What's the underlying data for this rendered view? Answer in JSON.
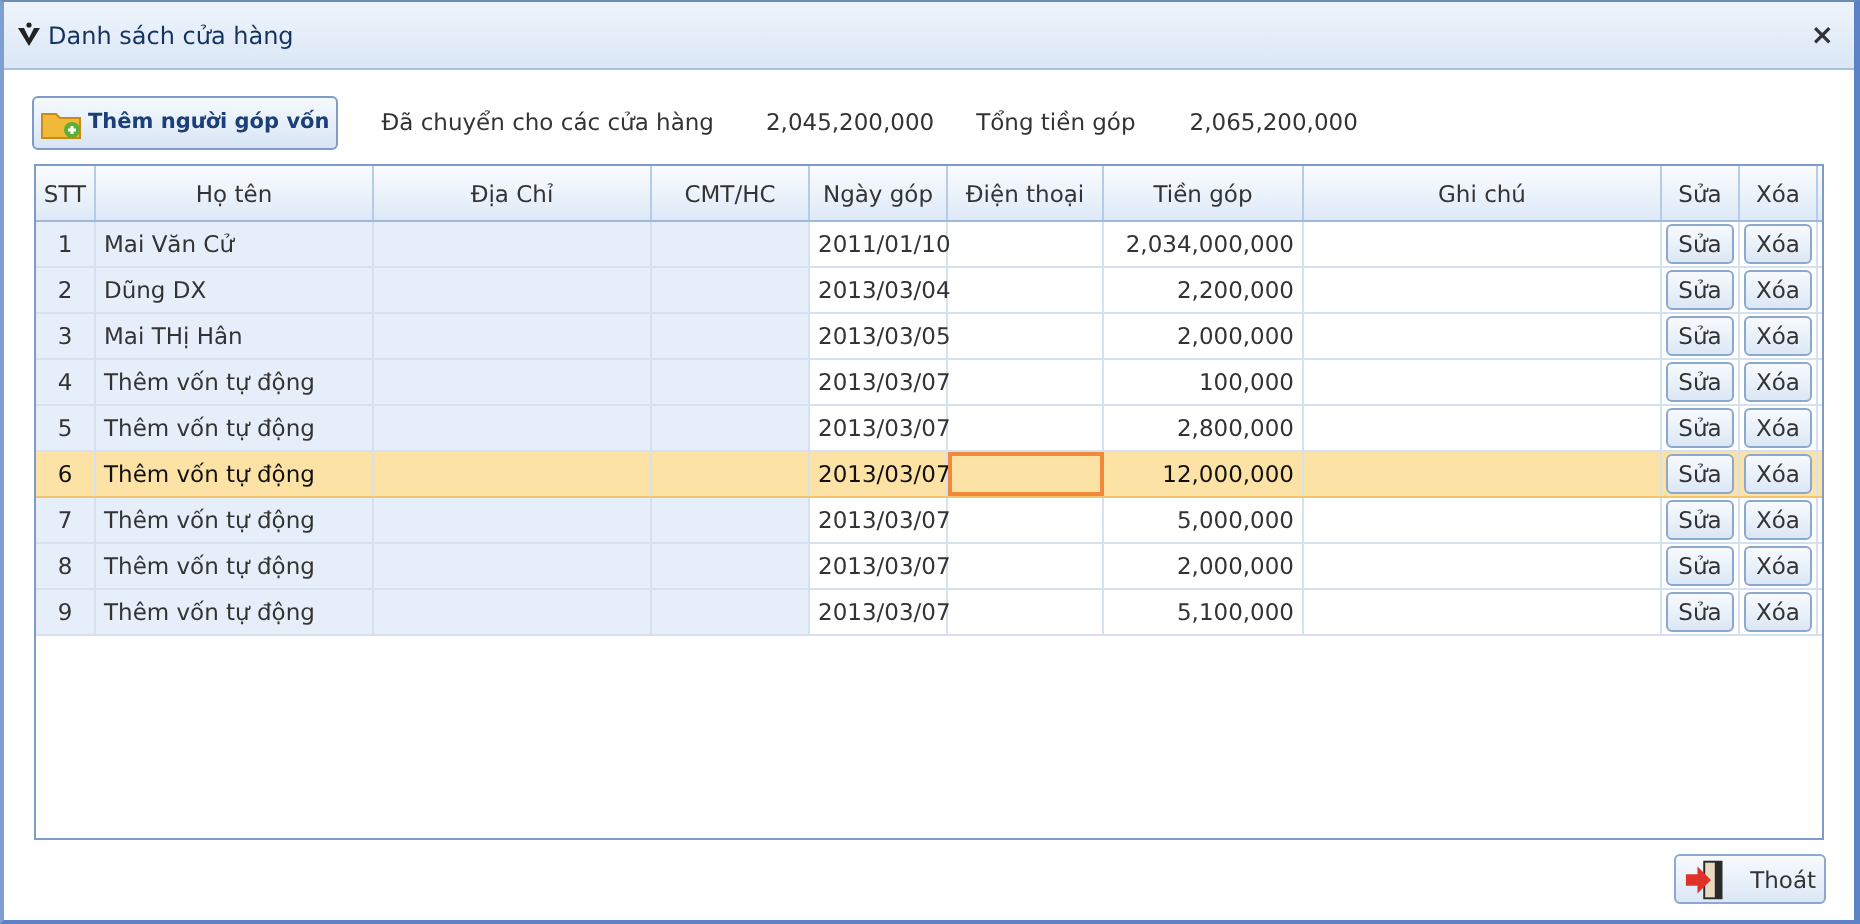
{
  "window": {
    "title": "Danh sách cửa hàng",
    "close": "×"
  },
  "toolbar": {
    "add_button": "Thêm người góp vốn",
    "transferred_label": "Đã chuyển cho các cửa hàng",
    "transferred_value": "2,045,200,000",
    "total_label": "Tổng tiền góp",
    "total_value": "2,065,200,000"
  },
  "table": {
    "columns": [
      "STT",
      "Họ tên",
      "Địa Chỉ",
      "CMT/HC",
      "Ngày góp",
      "Điện thoại",
      "Tiền góp",
      "Ghi chú",
      "Sửa",
      "Xóa"
    ],
    "rows": [
      {
        "stt": "1",
        "name": "Mai Văn Cử",
        "date": "2011/01/10",
        "amount": "2,034,000,000",
        "edit": "Sửa",
        "delete": "Xóa",
        "selected": false,
        "phone_focused": false
      },
      {
        "stt": "2",
        "name": "Dũng DX",
        "date": "2013/03/04",
        "amount": "2,200,000",
        "edit": "Sửa",
        "delete": "Xóa",
        "selected": false,
        "phone_focused": false
      },
      {
        "stt": "3",
        "name": "Mai THị Hân",
        "date": "2013/03/05",
        "amount": "2,000,000",
        "edit": "Sửa",
        "delete": "Xóa",
        "selected": false,
        "phone_focused": false
      },
      {
        "stt": "4",
        "name": "Thêm vốn tự động",
        "date": "2013/03/07",
        "amount": "100,000",
        "edit": "Sửa",
        "delete": "Xóa",
        "selected": false,
        "phone_focused": false
      },
      {
        "stt": "5",
        "name": "Thêm vốn tự động",
        "date": "2013/03/07",
        "amount": "2,800,000",
        "edit": "Sửa",
        "delete": "Xóa",
        "selected": false,
        "phone_focused": false
      },
      {
        "stt": "6",
        "name": "Thêm vốn tự động",
        "date": "2013/03/07",
        "amount": "12,000,000",
        "edit": "Sửa",
        "delete": "Xóa",
        "selected": true,
        "phone_focused": true
      },
      {
        "stt": "7",
        "name": "Thêm vốn tự động",
        "date": "2013/03/07",
        "amount": "5,000,000",
        "edit": "Sửa",
        "delete": "Xóa",
        "selected": false,
        "phone_focused": false
      },
      {
        "stt": "8",
        "name": "Thêm vốn tự động",
        "date": "2013/03/07",
        "amount": "2,000,000",
        "edit": "Sửa",
        "delete": "Xóa",
        "selected": false,
        "phone_focused": false
      },
      {
        "stt": "9",
        "name": "Thêm vốn tự động",
        "date": "2013/03/07",
        "amount": "5,100,000",
        "edit": "Sửa",
        "delete": "Xóa",
        "selected": false,
        "phone_focused": false
      }
    ]
  },
  "footer": {
    "exit_button": "Thoát"
  }
}
